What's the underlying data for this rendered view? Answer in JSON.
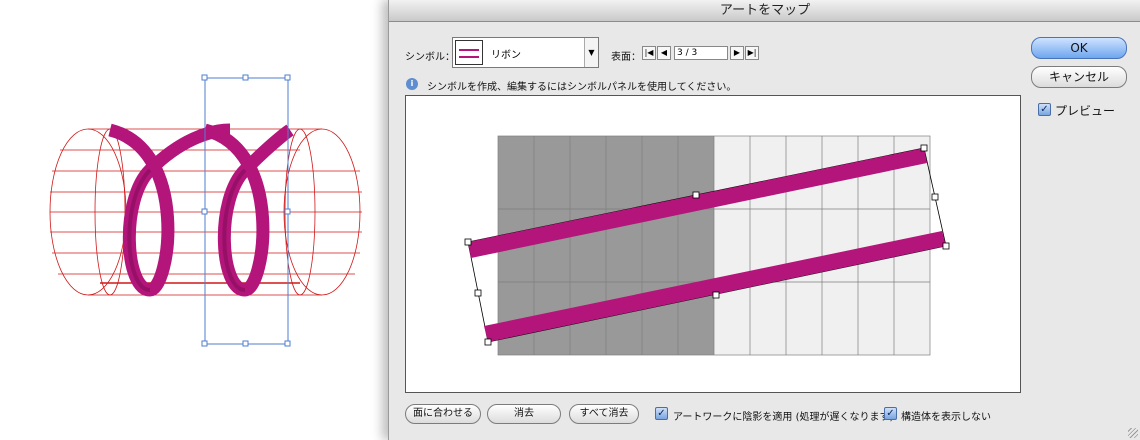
{
  "dialog": {
    "title": "アートをマップ",
    "symbol_label": "シンボル：",
    "symbol_value": "リボン",
    "surface_label": "表面：",
    "surface_value": "3 / 3",
    "info_text": "シンボルを作成、編集するにはシンボルパネルを使用してください。",
    "ok_label": "OK",
    "cancel_label": "キャンセル",
    "preview_label": "プレビュー",
    "preview_checked": true,
    "fit_button": "面に合わせる",
    "clear_button": "消去",
    "clear_all_button": "すべて消去",
    "shading_label": "アートワークに陰影を適用 (処理が遅くなります)",
    "shading_checked": true,
    "invisible_geometry_label": "構造体を表示しない",
    "invisible_geometry_checked": true
  },
  "colors": {
    "ribbon": "#b3157a",
    "wireframe": "#d01818",
    "selection": "#4f7fcf",
    "grid_dark": "#999999",
    "grid_light": "#f0f0f0"
  }
}
